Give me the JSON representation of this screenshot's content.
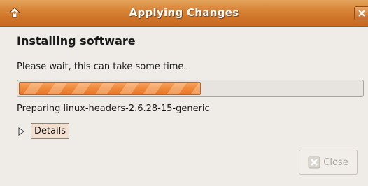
{
  "window": {
    "title": "Applying Changes"
  },
  "dialog": {
    "heading": "Installing software",
    "message": "Please wait, this can take some time.",
    "progress": {
      "fraction": 0.53
    },
    "status": "Preparing linux-headers-2.6.28-15-generic",
    "details_label": "Details",
    "close_label": "Close",
    "close_enabled": false
  },
  "icons": {
    "window_menu": "window-menu-icon",
    "title_close": "close-icon",
    "expander": "triangle-right-icon",
    "close_button": "close-icon"
  },
  "colors": {
    "titlebar": "#d8873a",
    "progress": "#f08a3a",
    "background": "#efebe7"
  }
}
